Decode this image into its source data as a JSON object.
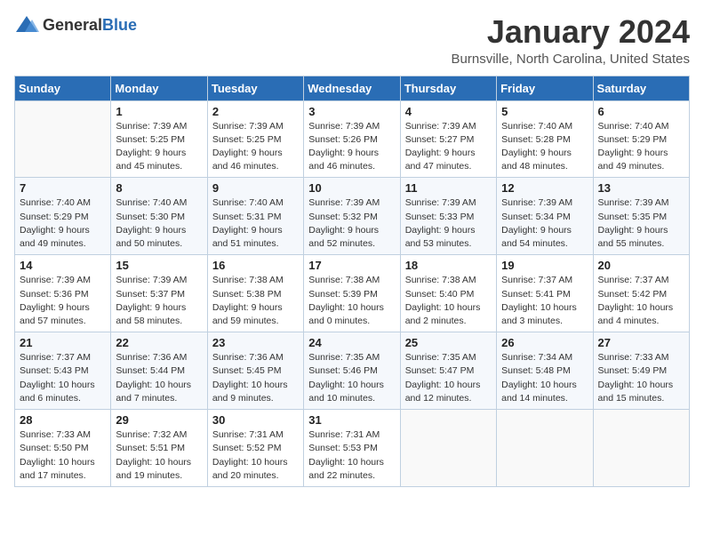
{
  "logo": {
    "general": "General",
    "blue": "Blue"
  },
  "title": "January 2024",
  "subtitle": "Burnsville, North Carolina, United States",
  "days_header": [
    "Sunday",
    "Monday",
    "Tuesday",
    "Wednesday",
    "Thursday",
    "Friday",
    "Saturday"
  ],
  "weeks": [
    [
      {
        "day": "",
        "info": ""
      },
      {
        "day": "1",
        "info": "Sunrise: 7:39 AM\nSunset: 5:25 PM\nDaylight: 9 hours\nand 45 minutes."
      },
      {
        "day": "2",
        "info": "Sunrise: 7:39 AM\nSunset: 5:25 PM\nDaylight: 9 hours\nand 46 minutes."
      },
      {
        "day": "3",
        "info": "Sunrise: 7:39 AM\nSunset: 5:26 PM\nDaylight: 9 hours\nand 46 minutes."
      },
      {
        "day": "4",
        "info": "Sunrise: 7:39 AM\nSunset: 5:27 PM\nDaylight: 9 hours\nand 47 minutes."
      },
      {
        "day": "5",
        "info": "Sunrise: 7:40 AM\nSunset: 5:28 PM\nDaylight: 9 hours\nand 48 minutes."
      },
      {
        "day": "6",
        "info": "Sunrise: 7:40 AM\nSunset: 5:29 PM\nDaylight: 9 hours\nand 49 minutes."
      }
    ],
    [
      {
        "day": "7",
        "info": "Sunrise: 7:40 AM\nSunset: 5:29 PM\nDaylight: 9 hours\nand 49 minutes."
      },
      {
        "day": "8",
        "info": "Sunrise: 7:40 AM\nSunset: 5:30 PM\nDaylight: 9 hours\nand 50 minutes."
      },
      {
        "day": "9",
        "info": "Sunrise: 7:40 AM\nSunset: 5:31 PM\nDaylight: 9 hours\nand 51 minutes."
      },
      {
        "day": "10",
        "info": "Sunrise: 7:39 AM\nSunset: 5:32 PM\nDaylight: 9 hours\nand 52 minutes."
      },
      {
        "day": "11",
        "info": "Sunrise: 7:39 AM\nSunset: 5:33 PM\nDaylight: 9 hours\nand 53 minutes."
      },
      {
        "day": "12",
        "info": "Sunrise: 7:39 AM\nSunset: 5:34 PM\nDaylight: 9 hours\nand 54 minutes."
      },
      {
        "day": "13",
        "info": "Sunrise: 7:39 AM\nSunset: 5:35 PM\nDaylight: 9 hours\nand 55 minutes."
      }
    ],
    [
      {
        "day": "14",
        "info": "Sunrise: 7:39 AM\nSunset: 5:36 PM\nDaylight: 9 hours\nand 57 minutes."
      },
      {
        "day": "15",
        "info": "Sunrise: 7:39 AM\nSunset: 5:37 PM\nDaylight: 9 hours\nand 58 minutes."
      },
      {
        "day": "16",
        "info": "Sunrise: 7:38 AM\nSunset: 5:38 PM\nDaylight: 9 hours\nand 59 minutes."
      },
      {
        "day": "17",
        "info": "Sunrise: 7:38 AM\nSunset: 5:39 PM\nDaylight: 10 hours\nand 0 minutes."
      },
      {
        "day": "18",
        "info": "Sunrise: 7:38 AM\nSunset: 5:40 PM\nDaylight: 10 hours\nand 2 minutes."
      },
      {
        "day": "19",
        "info": "Sunrise: 7:37 AM\nSunset: 5:41 PM\nDaylight: 10 hours\nand 3 minutes."
      },
      {
        "day": "20",
        "info": "Sunrise: 7:37 AM\nSunset: 5:42 PM\nDaylight: 10 hours\nand 4 minutes."
      }
    ],
    [
      {
        "day": "21",
        "info": "Sunrise: 7:37 AM\nSunset: 5:43 PM\nDaylight: 10 hours\nand 6 minutes."
      },
      {
        "day": "22",
        "info": "Sunrise: 7:36 AM\nSunset: 5:44 PM\nDaylight: 10 hours\nand 7 minutes."
      },
      {
        "day": "23",
        "info": "Sunrise: 7:36 AM\nSunset: 5:45 PM\nDaylight: 10 hours\nand 9 minutes."
      },
      {
        "day": "24",
        "info": "Sunrise: 7:35 AM\nSunset: 5:46 PM\nDaylight: 10 hours\nand 10 minutes."
      },
      {
        "day": "25",
        "info": "Sunrise: 7:35 AM\nSunset: 5:47 PM\nDaylight: 10 hours\nand 12 minutes."
      },
      {
        "day": "26",
        "info": "Sunrise: 7:34 AM\nSunset: 5:48 PM\nDaylight: 10 hours\nand 14 minutes."
      },
      {
        "day": "27",
        "info": "Sunrise: 7:33 AM\nSunset: 5:49 PM\nDaylight: 10 hours\nand 15 minutes."
      }
    ],
    [
      {
        "day": "28",
        "info": "Sunrise: 7:33 AM\nSunset: 5:50 PM\nDaylight: 10 hours\nand 17 minutes."
      },
      {
        "day": "29",
        "info": "Sunrise: 7:32 AM\nSunset: 5:51 PM\nDaylight: 10 hours\nand 19 minutes."
      },
      {
        "day": "30",
        "info": "Sunrise: 7:31 AM\nSunset: 5:52 PM\nDaylight: 10 hours\nand 20 minutes."
      },
      {
        "day": "31",
        "info": "Sunrise: 7:31 AM\nSunset: 5:53 PM\nDaylight: 10 hours\nand 22 minutes."
      },
      {
        "day": "",
        "info": ""
      },
      {
        "day": "",
        "info": ""
      },
      {
        "day": "",
        "info": ""
      }
    ]
  ]
}
